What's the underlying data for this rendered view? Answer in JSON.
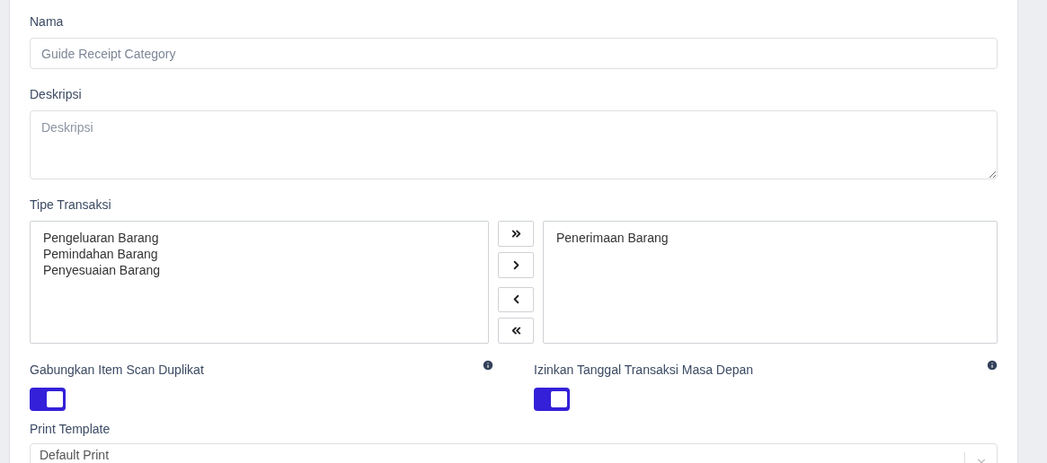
{
  "nama": {
    "label": "Nama",
    "placeholder": "Guide Receipt Category"
  },
  "deskripsi": {
    "label": "Deskripsi",
    "placeholder": "Deskripsi"
  },
  "tipe_transaksi": {
    "label": "Tipe Transaksi",
    "available": [
      "Pengeluaran Barang",
      "Pemindahan Barang",
      "Penyesuaian Barang"
    ],
    "move_buttons": [
      {
        "kind": "all_right"
      },
      {
        "kind": "right"
      },
      {
        "kind": "left"
      },
      {
        "kind": "all_left"
      }
    ],
    "chosen": [
      "Penerimaan Barang"
    ]
  },
  "toggles": [
    {
      "label": "Gabungkan Item Scan Duplikat",
      "on": true
    },
    {
      "label": "Izinkan Tanggal Transaksi Masa Depan",
      "on": true
    }
  ],
  "print_template": {
    "label": "Print Template",
    "value": "Default Print"
  }
}
